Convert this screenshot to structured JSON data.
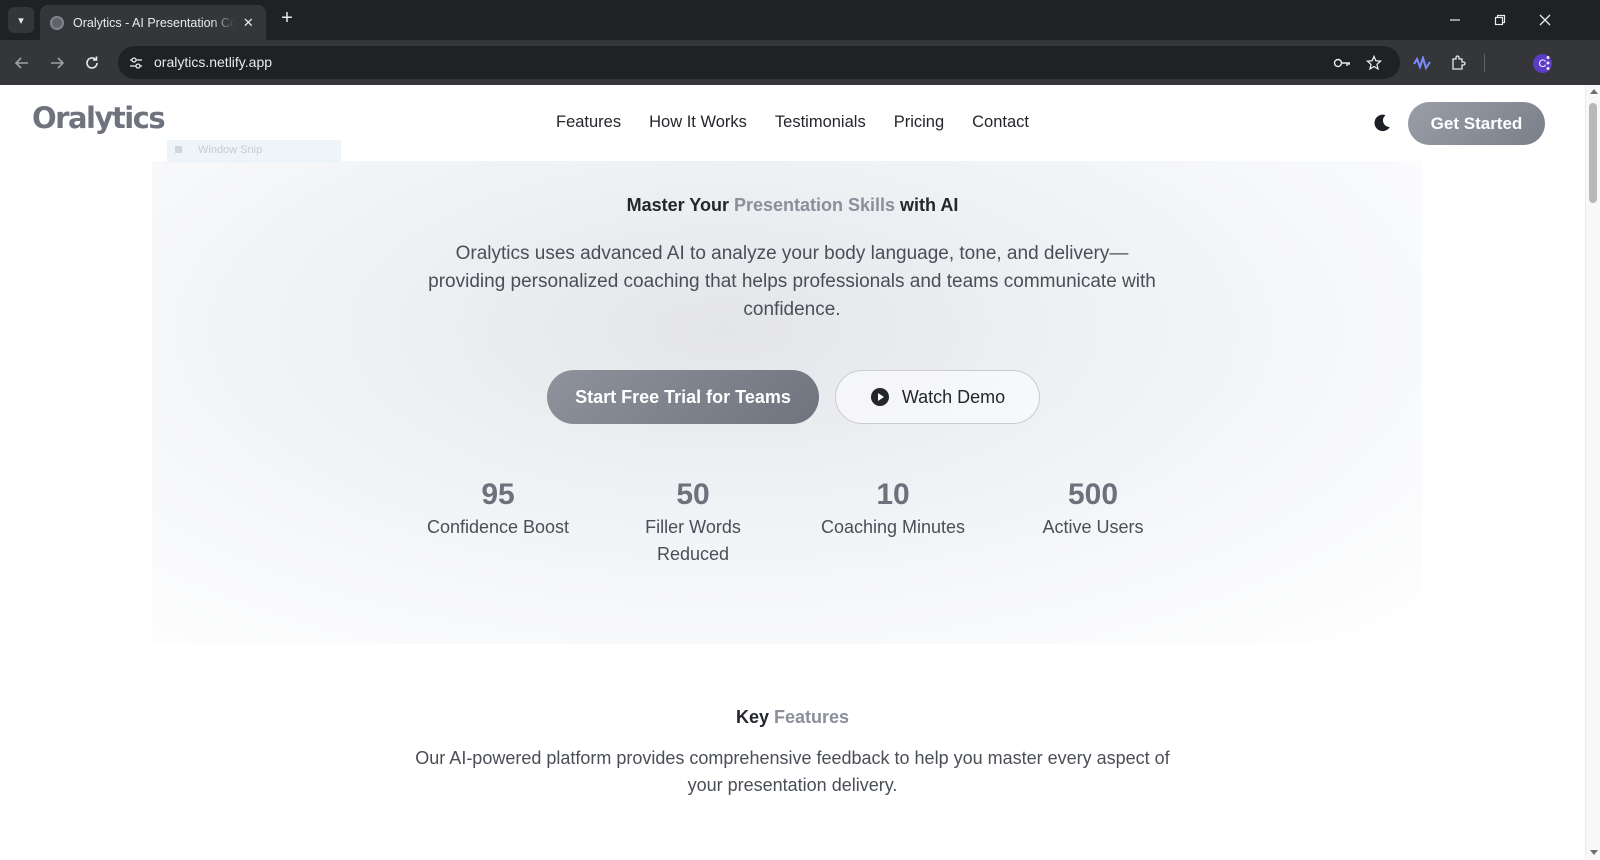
{
  "browser": {
    "tab_title": "Oralytics - AI Presentation Coach",
    "tab_close_glyph": "✕",
    "new_tab_glyph": "+",
    "url": "oralytics.netlify.app",
    "profile_initial": "C",
    "icons": [
      "tab-search-icon",
      "favicon-icon",
      "close-icon",
      "plus-icon",
      "minimize-icon",
      "restore-icon",
      "close-window-icon",
      "back-icon",
      "forward-icon",
      "reload-icon",
      "site-info-icon",
      "password-key-icon",
      "bookmark-star-icon",
      "extension-wave-icon",
      "extensions-puzzle-icon",
      "kebab-menu-icon"
    ]
  },
  "site": {
    "logo": "Oralytics",
    "nav": [
      {
        "label": "Features"
      },
      {
        "label": "How It Works"
      },
      {
        "label": "Testimonials"
      },
      {
        "label": "Pricing"
      },
      {
        "label": "Contact"
      }
    ],
    "cta": "Get Started",
    "theme_icon": "moon-icon",
    "colors": {
      "accent_gray": "#8a8f99",
      "button_gray": "#7a7f8a",
      "text_dark": "#23262b"
    }
  },
  "overlay": {
    "window_snip": "Window Snip"
  },
  "hero": {
    "title_before": "Master Your ",
    "title_accent": "Presentation Skills",
    "title_after": " with AI",
    "description": "Oralytics uses advanced AI to analyze your body language, tone, and delivery—providing personalized coaching that helps professionals and teams communicate with confidence.",
    "primary_button": "Start Free Trial for Teams",
    "secondary_button": "Watch Demo",
    "stats": [
      {
        "value": "95",
        "label": "Confidence Boost"
      },
      {
        "value": "50",
        "label": "Filler Words Reduced"
      },
      {
        "value": "10",
        "label": "Coaching Minutes"
      },
      {
        "value": "500",
        "label": "Active Users"
      }
    ]
  },
  "features_section": {
    "title_plain": "Key ",
    "title_accent": "Features",
    "description": "Our AI-powered platform provides comprehensive feedback to help you master every aspect of your presentation delivery."
  }
}
